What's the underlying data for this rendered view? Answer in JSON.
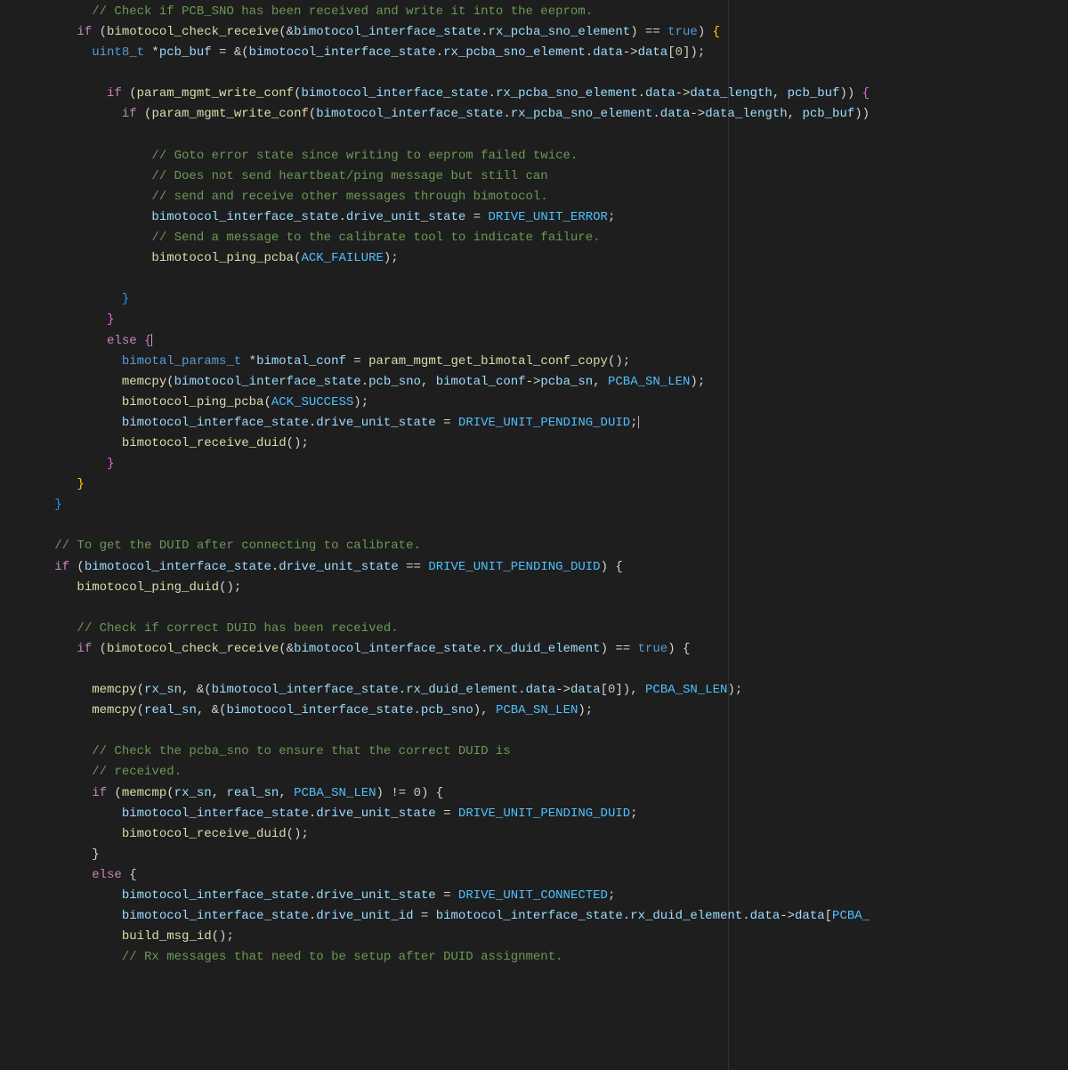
{
  "lines": [
    {
      "indent": 8,
      "segments": [
        {
          "cls": "cmt",
          "t": "// Check if PCB_SNO has been received and write it into the eeprom."
        }
      ]
    },
    {
      "indent": 6,
      "segments": [
        {
          "cls": "kw",
          "t": "if"
        },
        {
          "cls": "op",
          "t": " ("
        },
        {
          "cls": "fn",
          "t": "bimotocol_check_receive"
        },
        {
          "cls": "op",
          "t": "(&"
        },
        {
          "cls": "var",
          "t": "bimotocol_interface_state"
        },
        {
          "cls": "op",
          "t": "."
        },
        {
          "cls": "var",
          "t": "rx_pcba_sno_element"
        },
        {
          "cls": "op",
          "t": ") == "
        },
        {
          "cls": "type",
          "t": "true"
        },
        {
          "cls": "op",
          "t": ") "
        },
        {
          "cls": "brace-y",
          "t": "{"
        }
      ]
    },
    {
      "indent": 8,
      "segments": [
        {
          "cls": "type",
          "t": "uint8_t"
        },
        {
          "cls": "op",
          "t": " *"
        },
        {
          "cls": "var",
          "t": "pcb_buf"
        },
        {
          "cls": "op",
          "t": " = &("
        },
        {
          "cls": "var",
          "t": "bimotocol_interface_state"
        },
        {
          "cls": "op",
          "t": "."
        },
        {
          "cls": "var",
          "t": "rx_pcba_sno_element"
        },
        {
          "cls": "op",
          "t": "."
        },
        {
          "cls": "var",
          "t": "data"
        },
        {
          "cls": "op",
          "t": "->"
        },
        {
          "cls": "var",
          "t": "data"
        },
        {
          "cls": "op",
          "t": "["
        },
        {
          "cls": "num",
          "t": "0"
        },
        {
          "cls": "op",
          "t": "]);"
        }
      ]
    },
    {
      "indent": 0,
      "segments": [
        {
          "cls": "op",
          "t": ""
        }
      ]
    },
    {
      "indent": 10,
      "segments": [
        {
          "cls": "kw",
          "t": "if"
        },
        {
          "cls": "op",
          "t": " ("
        },
        {
          "cls": "fn",
          "t": "param_mgmt_write_conf"
        },
        {
          "cls": "op",
          "t": "("
        },
        {
          "cls": "var",
          "t": "bimotocol_interface_state"
        },
        {
          "cls": "op",
          "t": "."
        },
        {
          "cls": "var",
          "t": "rx_pcba_sno_element"
        },
        {
          "cls": "op",
          "t": "."
        },
        {
          "cls": "var",
          "t": "data"
        },
        {
          "cls": "op",
          "t": "->"
        },
        {
          "cls": "var",
          "t": "data_length"
        },
        {
          "cls": "op",
          "t": ", "
        },
        {
          "cls": "var",
          "t": "pcb_buf"
        },
        {
          "cls": "op",
          "t": ")) "
        },
        {
          "cls": "brace-p",
          "t": "{"
        }
      ]
    },
    {
      "indent": 12,
      "segments": [
        {
          "cls": "kw",
          "t": "if"
        },
        {
          "cls": "op",
          "t": " ("
        },
        {
          "cls": "fn",
          "t": "param_mgmt_write_conf"
        },
        {
          "cls": "op",
          "t": "("
        },
        {
          "cls": "var",
          "t": "bimotocol_interface_state"
        },
        {
          "cls": "op",
          "t": "."
        },
        {
          "cls": "var",
          "t": "rx_pcba_sno_element"
        },
        {
          "cls": "op",
          "t": "."
        },
        {
          "cls": "var",
          "t": "data"
        },
        {
          "cls": "op",
          "t": "->"
        },
        {
          "cls": "var",
          "t": "data_length"
        },
        {
          "cls": "op",
          "t": ", "
        },
        {
          "cls": "var",
          "t": "pcb_buf"
        },
        {
          "cls": "op",
          "t": "))"
        }
      ]
    },
    {
      "indent": 0,
      "segments": [
        {
          "cls": "op",
          "t": ""
        }
      ]
    },
    {
      "indent": 16,
      "segments": [
        {
          "cls": "cmt",
          "t": "// Goto error state since writing to eeprom failed twice."
        }
      ]
    },
    {
      "indent": 16,
      "segments": [
        {
          "cls": "cmt",
          "t": "// Does not send heartbeat/ping message but still can"
        }
      ]
    },
    {
      "indent": 16,
      "segments": [
        {
          "cls": "cmt",
          "t": "// send and receive other messages through bimotocol."
        }
      ]
    },
    {
      "indent": 16,
      "segments": [
        {
          "cls": "var",
          "t": "bimotocol_interface_state"
        },
        {
          "cls": "op",
          "t": "."
        },
        {
          "cls": "var",
          "t": "drive_unit_state"
        },
        {
          "cls": "op",
          "t": " = "
        },
        {
          "cls": "const",
          "t": "DRIVE_UNIT_ERROR"
        },
        {
          "cls": "op",
          "t": ";"
        }
      ]
    },
    {
      "indent": 16,
      "segments": [
        {
          "cls": "cmt",
          "t": "// Send a message to the calibrate tool to indicate failure."
        }
      ]
    },
    {
      "indent": 16,
      "segments": [
        {
          "cls": "fn",
          "t": "bimotocol_ping_pcba"
        },
        {
          "cls": "op",
          "t": "("
        },
        {
          "cls": "const",
          "t": "ACK_FAILURE"
        },
        {
          "cls": "op",
          "t": ");"
        }
      ]
    },
    {
      "indent": 0,
      "segments": [
        {
          "cls": "op",
          "t": ""
        }
      ]
    },
    {
      "indent": 12,
      "segments": [
        {
          "cls": "brace-b",
          "t": "}"
        }
      ]
    },
    {
      "indent": 10,
      "segments": [
        {
          "cls": "brace-p",
          "t": "}"
        }
      ]
    },
    {
      "indent": 10,
      "segments": [
        {
          "cls": "kw",
          "t": "else"
        },
        {
          "cls": "op",
          "t": " "
        },
        {
          "cls": "brace-p",
          "t": "{"
        },
        {
          "cls": "cursor",
          "t": ""
        }
      ]
    },
    {
      "indent": 12,
      "segments": [
        {
          "cls": "type",
          "t": "bimotal_params_t"
        },
        {
          "cls": "op",
          "t": " *"
        },
        {
          "cls": "var",
          "t": "bimotal_conf"
        },
        {
          "cls": "op",
          "t": " = "
        },
        {
          "cls": "fn",
          "t": "param_mgmt_get_bimotal_conf_copy"
        },
        {
          "cls": "op",
          "t": "();"
        }
      ]
    },
    {
      "indent": 12,
      "segments": [
        {
          "cls": "fn",
          "t": "memcpy"
        },
        {
          "cls": "op",
          "t": "("
        },
        {
          "cls": "var",
          "t": "bimotocol_interface_state"
        },
        {
          "cls": "op",
          "t": "."
        },
        {
          "cls": "var",
          "t": "pcb_sno"
        },
        {
          "cls": "op",
          "t": ", "
        },
        {
          "cls": "var",
          "t": "bimotal_conf"
        },
        {
          "cls": "op",
          "t": "->"
        },
        {
          "cls": "var",
          "t": "pcba_sn"
        },
        {
          "cls": "op",
          "t": ", "
        },
        {
          "cls": "const",
          "t": "PCBA_SN_LEN"
        },
        {
          "cls": "op",
          "t": ");"
        }
      ]
    },
    {
      "indent": 12,
      "segments": [
        {
          "cls": "fn",
          "t": "bimotocol_ping_pcba"
        },
        {
          "cls": "op",
          "t": "("
        },
        {
          "cls": "const",
          "t": "ACK_SUCCESS"
        },
        {
          "cls": "op",
          "t": ");"
        }
      ]
    },
    {
      "indent": 12,
      "segments": [
        {
          "cls": "var",
          "t": "bimotocol_interface_state"
        },
        {
          "cls": "op",
          "t": "."
        },
        {
          "cls": "var",
          "t": "drive_unit_state"
        },
        {
          "cls": "op",
          "t": " = "
        },
        {
          "cls": "const",
          "t": "DRIVE_UNIT_PENDING_DUID"
        },
        {
          "cls": "op",
          "t": ";"
        },
        {
          "cls": "cursor",
          "t": ""
        }
      ]
    },
    {
      "indent": 12,
      "segments": [
        {
          "cls": "fn",
          "t": "bimotocol_receive_duid"
        },
        {
          "cls": "op",
          "t": "();"
        }
      ]
    },
    {
      "indent": 10,
      "segments": [
        {
          "cls": "brace-p",
          "t": "}"
        }
      ]
    },
    {
      "indent": 6,
      "segments": [
        {
          "cls": "brace-y",
          "t": "}"
        }
      ]
    },
    {
      "indent": 3,
      "segments": [
        {
          "cls": "brace-b",
          "t": "}"
        }
      ]
    },
    {
      "indent": 0,
      "segments": [
        {
          "cls": "op",
          "t": ""
        }
      ]
    },
    {
      "indent": 3,
      "segments": [
        {
          "cls": "cmt",
          "t": "// To get the DUID after connecting to calibrate."
        }
      ]
    },
    {
      "indent": 3,
      "segments": [
        {
          "cls": "kw",
          "t": "if"
        },
        {
          "cls": "op",
          "t": " ("
        },
        {
          "cls": "var",
          "t": "bimotocol_interface_state"
        },
        {
          "cls": "op",
          "t": "."
        },
        {
          "cls": "var",
          "t": "drive_unit_state"
        },
        {
          "cls": "op",
          "t": " == "
        },
        {
          "cls": "const",
          "t": "DRIVE_UNIT_PENDING_DUID"
        },
        {
          "cls": "op",
          "t": ") {"
        }
      ]
    },
    {
      "indent": 6,
      "segments": [
        {
          "cls": "fn",
          "t": "bimotocol_ping_duid"
        },
        {
          "cls": "op",
          "t": "();"
        }
      ]
    },
    {
      "indent": 0,
      "segments": [
        {
          "cls": "op",
          "t": ""
        }
      ]
    },
    {
      "indent": 6,
      "segments": [
        {
          "cls": "cmt",
          "t": "// Check if correct DUID has been received."
        }
      ]
    },
    {
      "indent": 6,
      "segments": [
        {
          "cls": "kw",
          "t": "if"
        },
        {
          "cls": "op",
          "t": " ("
        },
        {
          "cls": "fn",
          "t": "bimotocol_check_receive"
        },
        {
          "cls": "op",
          "t": "(&"
        },
        {
          "cls": "var",
          "t": "bimotocol_interface_state"
        },
        {
          "cls": "op",
          "t": "."
        },
        {
          "cls": "var",
          "t": "rx_duid_element"
        },
        {
          "cls": "op",
          "t": ") == "
        },
        {
          "cls": "type",
          "t": "true"
        },
        {
          "cls": "op",
          "t": ") {"
        }
      ]
    },
    {
      "indent": 0,
      "segments": [
        {
          "cls": "op",
          "t": ""
        }
      ]
    },
    {
      "indent": 8,
      "segments": [
        {
          "cls": "fn",
          "t": "memcpy"
        },
        {
          "cls": "op",
          "t": "("
        },
        {
          "cls": "var",
          "t": "rx_sn"
        },
        {
          "cls": "op",
          "t": ", &("
        },
        {
          "cls": "var",
          "t": "bimotocol_interface_state"
        },
        {
          "cls": "op",
          "t": "."
        },
        {
          "cls": "var",
          "t": "rx_duid_element"
        },
        {
          "cls": "op",
          "t": "."
        },
        {
          "cls": "var",
          "t": "data"
        },
        {
          "cls": "op",
          "t": "->"
        },
        {
          "cls": "var",
          "t": "data"
        },
        {
          "cls": "op",
          "t": "["
        },
        {
          "cls": "num",
          "t": "0"
        },
        {
          "cls": "op",
          "t": "]), "
        },
        {
          "cls": "const",
          "t": "PCBA_SN_LEN"
        },
        {
          "cls": "op",
          "t": ");"
        }
      ]
    },
    {
      "indent": 8,
      "segments": [
        {
          "cls": "fn",
          "t": "memcpy"
        },
        {
          "cls": "op",
          "t": "("
        },
        {
          "cls": "var",
          "t": "real_sn"
        },
        {
          "cls": "op",
          "t": ", &("
        },
        {
          "cls": "var",
          "t": "bimotocol_interface_state"
        },
        {
          "cls": "op",
          "t": "."
        },
        {
          "cls": "var",
          "t": "pcb_sno"
        },
        {
          "cls": "op",
          "t": "), "
        },
        {
          "cls": "const",
          "t": "PCBA_SN_LEN"
        },
        {
          "cls": "op",
          "t": ");"
        }
      ]
    },
    {
      "indent": 0,
      "segments": [
        {
          "cls": "op",
          "t": ""
        }
      ]
    },
    {
      "indent": 8,
      "segments": [
        {
          "cls": "cmt",
          "t": "// Check the pcba_sno to ensure that the correct DUID is"
        }
      ]
    },
    {
      "indent": 8,
      "segments": [
        {
          "cls": "cmt",
          "t": "// received."
        }
      ]
    },
    {
      "indent": 8,
      "segments": [
        {
          "cls": "kw",
          "t": "if"
        },
        {
          "cls": "op",
          "t": " ("
        },
        {
          "cls": "fn",
          "t": "memcmp"
        },
        {
          "cls": "op",
          "t": "("
        },
        {
          "cls": "var",
          "t": "rx_sn"
        },
        {
          "cls": "op",
          "t": ", "
        },
        {
          "cls": "var",
          "t": "real_sn"
        },
        {
          "cls": "op",
          "t": ", "
        },
        {
          "cls": "const",
          "t": "PCBA_SN_LEN"
        },
        {
          "cls": "op",
          "t": ") != "
        },
        {
          "cls": "num",
          "t": "0"
        },
        {
          "cls": "op",
          "t": ") {"
        }
      ]
    },
    {
      "indent": 12,
      "segments": [
        {
          "cls": "var",
          "t": "bimotocol_interface_state"
        },
        {
          "cls": "op",
          "t": "."
        },
        {
          "cls": "var",
          "t": "drive_unit_state"
        },
        {
          "cls": "op",
          "t": " = "
        },
        {
          "cls": "const",
          "t": "DRIVE_UNIT_PENDING_DUID"
        },
        {
          "cls": "op",
          "t": ";"
        }
      ]
    },
    {
      "indent": 12,
      "segments": [
        {
          "cls": "fn",
          "t": "bimotocol_receive_duid"
        },
        {
          "cls": "op",
          "t": "();"
        }
      ]
    },
    {
      "indent": 8,
      "segments": [
        {
          "cls": "op",
          "t": "}"
        }
      ]
    },
    {
      "indent": 8,
      "segments": [
        {
          "cls": "kw",
          "t": "else"
        },
        {
          "cls": "op",
          "t": " {"
        }
      ]
    },
    {
      "indent": 12,
      "segments": [
        {
          "cls": "var",
          "t": "bimotocol_interface_state"
        },
        {
          "cls": "op",
          "t": "."
        },
        {
          "cls": "var",
          "t": "drive_unit_state"
        },
        {
          "cls": "op",
          "t": " = "
        },
        {
          "cls": "const",
          "t": "DRIVE_UNIT_CONNECTED"
        },
        {
          "cls": "op",
          "t": ";"
        }
      ]
    },
    {
      "indent": 12,
      "segments": [
        {
          "cls": "var",
          "t": "bimotocol_interface_state"
        },
        {
          "cls": "op",
          "t": "."
        },
        {
          "cls": "var",
          "t": "drive_unit_id"
        },
        {
          "cls": "op",
          "t": " = "
        },
        {
          "cls": "var",
          "t": "bimotocol_interface_state"
        },
        {
          "cls": "op",
          "t": "."
        },
        {
          "cls": "var",
          "t": "rx_duid_element"
        },
        {
          "cls": "op",
          "t": "."
        },
        {
          "cls": "var",
          "t": "data"
        },
        {
          "cls": "op",
          "t": "->"
        },
        {
          "cls": "var",
          "t": "data"
        },
        {
          "cls": "op",
          "t": "["
        },
        {
          "cls": "const",
          "t": "PCBA_"
        }
      ]
    },
    {
      "indent": 12,
      "segments": [
        {
          "cls": "fn",
          "t": "build_msg_id"
        },
        {
          "cls": "op",
          "t": "();"
        }
      ]
    },
    {
      "indent": 12,
      "segments": [
        {
          "cls": "cmt",
          "t": "// Rx messages that need to be setup after DUID assignment."
        }
      ]
    }
  ]
}
